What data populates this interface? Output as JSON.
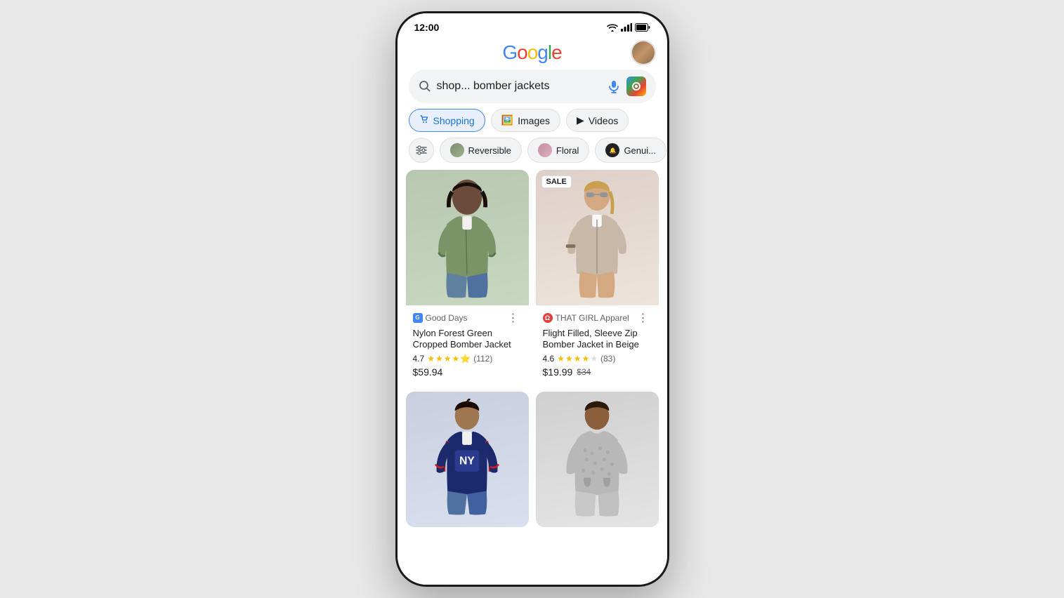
{
  "phone": {
    "status_time": "12:00"
  },
  "header": {
    "logo_text": "Google",
    "avatar_alt": "User avatar"
  },
  "search": {
    "query": "shop... bomber jackets",
    "placeholder": "shop... bomber jackets",
    "mic_label": "Voice search",
    "lens_label": "Google Lens"
  },
  "tabs": [
    {
      "label": "Shopping",
      "icon": "🛍️",
      "active": true
    },
    {
      "label": "Images",
      "icon": "🖼️",
      "active": false
    },
    {
      "label": "Videos",
      "icon": "▶️",
      "active": false
    }
  ],
  "sub_filters": [
    {
      "label": "Reversible",
      "icon": "🧥"
    },
    {
      "label": "Floral",
      "icon": "👗"
    },
    {
      "label": "Genui...",
      "icon": "🔔"
    }
  ],
  "products": [
    {
      "seller": "Good Days",
      "seller_icon": "G",
      "title": "Nylon Forest Green Cropped Bomber Jacket",
      "rating": "4.7",
      "stars": 4.5,
      "review_count": "(112)",
      "price": "$59.94",
      "price_original": "",
      "sale": false,
      "image_type": "green"
    },
    {
      "seller": "THAT GIRL Apparel",
      "seller_icon": "Ω",
      "title": "Flight Filled, Sleeve Zip Bomber Jacket in Beige",
      "rating": "4.6",
      "stars": 4.5,
      "review_count": "(83)",
      "price": "$19.99",
      "price_original": "$34",
      "sale": true,
      "image_type": "beige"
    },
    {
      "seller": "",
      "seller_icon": "",
      "title": "",
      "rating": "",
      "stars": 0,
      "review_count": "",
      "price": "",
      "price_original": "",
      "sale": false,
      "image_type": "blue"
    },
    {
      "seller": "",
      "seller_icon": "",
      "title": "",
      "rating": "",
      "stars": 0,
      "review_count": "",
      "price": "",
      "price_original": "",
      "sale": false,
      "image_type": "gray"
    }
  ]
}
